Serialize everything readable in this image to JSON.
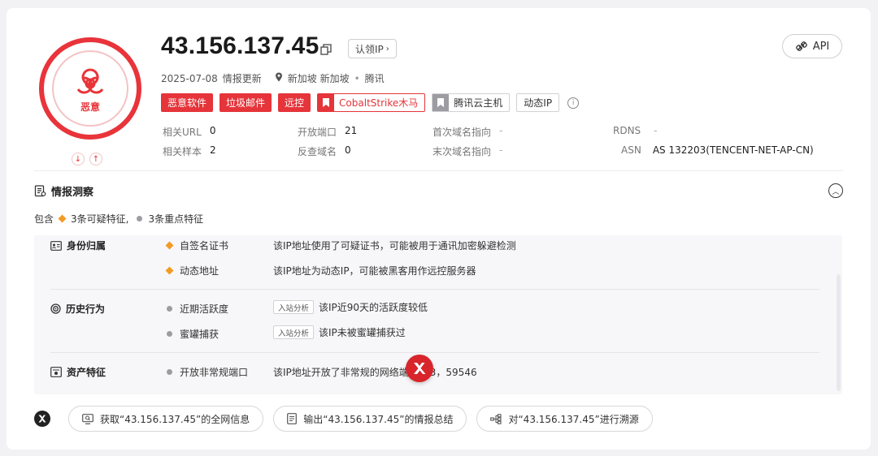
{
  "header": {
    "ip": "43.156.137.45",
    "claim_label": "认领IP",
    "api_label": "API",
    "date": "2025-07-08",
    "date_suffix": "情报更新",
    "location": "新加坡 新加坡",
    "isp_sep": "•",
    "isp": "腾讯"
  },
  "verdict": {
    "label": "恶意",
    "color": "#e8343a",
    "icon": "biohazard-icon"
  },
  "tags": {
    "malware": "恶意软件",
    "spam": "垃圾邮件",
    "remote": "远控",
    "trojan": "CobaltStrike木马",
    "cloud": "腾讯云主机",
    "dynamic": "动态IP"
  },
  "stats": {
    "related_url_label": "相关URL",
    "related_url_value": "0",
    "related_sample_label": "相关样本",
    "related_sample_value": "2",
    "open_ports_label": "开放端口",
    "open_ports_value": "21",
    "reverse_domain_label": "反查域名",
    "reverse_domain_value": "0",
    "first_domain_label": "首次域名指向",
    "first_domain_value": "-",
    "last_domain_label": "末次域名指向",
    "last_domain_value": "-",
    "rdns_label": "RDNS",
    "rdns_value": "-",
    "asn_label": "ASN",
    "asn_value": "AS 132203(TENCENT-NET-AP-CN)"
  },
  "insight": {
    "title": "情报洞察",
    "summary_prefix": "包含",
    "suspicious": "3条可疑特征,",
    "key": "3条重点特征",
    "groups": [
      {
        "title": "身份归属",
        "items": [
          {
            "name": "自签名证书",
            "tag": "",
            "desc": "该IP地址使用了可疑证书，可能被用于通讯加密躲避检测"
          },
          {
            "name": "动态地址",
            "tag": "",
            "desc": "该IP地址为动态IP，可能被黑客用作远控服务器"
          }
        ]
      },
      {
        "title": "历史行为",
        "items": [
          {
            "name": "近期活跃度",
            "tag": "入站分析",
            "desc": "该IP近90天的活跃度较低"
          },
          {
            "name": "蜜罐捕获",
            "tag": "入站分析",
            "desc": "该IP未被蜜罐捕获过"
          }
        ]
      },
      {
        "title": "资产特征",
        "items": [
          {
            "name": "开放非常规端口",
            "tag": "",
            "desc_a": "该IP地址开放了非常规的网络端",
            "desc_b": "3，59546"
          }
        ]
      }
    ]
  },
  "actions": {
    "get_all": "获取“43.156.137.45”的全网信息",
    "export_summary": "输出“43.156.137.45”的情报总结",
    "trace": "对“43.156.137.45”进行溯源"
  },
  "colors": {
    "accent_red": "#e5343a",
    "warn_orange": "#f39b23",
    "neutral_gray": "#9c9ca2"
  }
}
